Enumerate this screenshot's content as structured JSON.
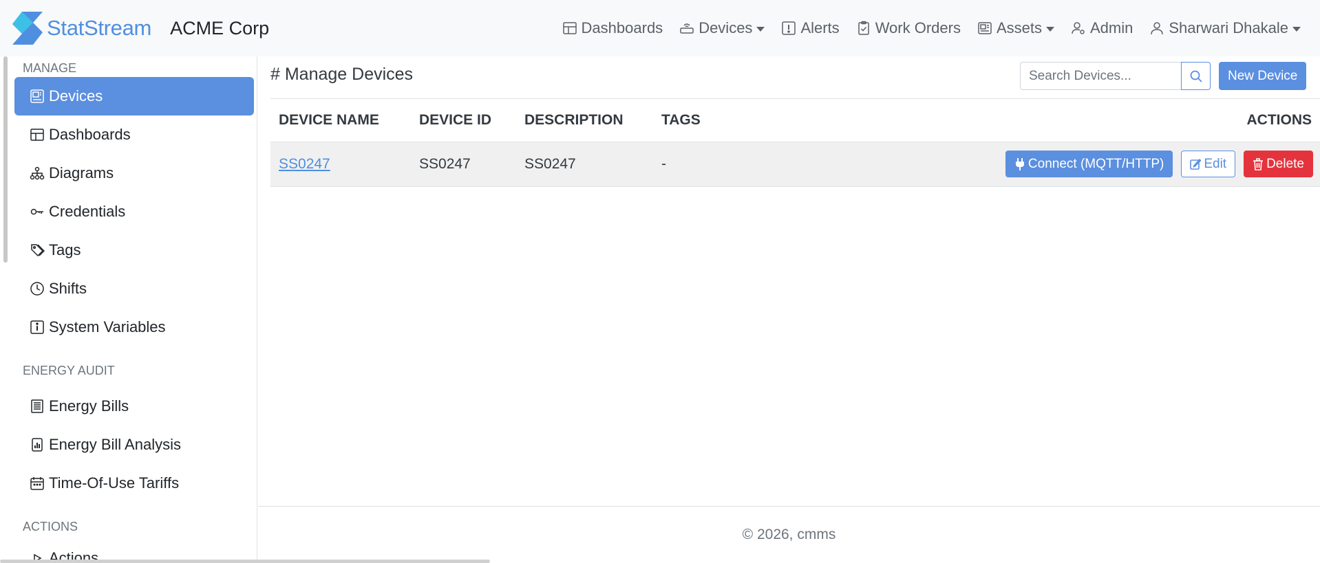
{
  "brand": {
    "name": "StatStream",
    "org": "ACME Corp",
    "colors": {
      "accent": "#5b8fdf",
      "danger": "#e5333d",
      "logo": "#4f8fe0"
    }
  },
  "nav": {
    "dashboards": "Dashboards",
    "devices": "Devices",
    "alerts": "Alerts",
    "work_orders": "Work Orders",
    "assets": "Assets",
    "admin": "Admin",
    "user": "Sharwari Dhakale"
  },
  "sidebar": {
    "manage_title": "MANAGE",
    "manage_items": [
      {
        "label": "Devices",
        "icon": "device-icon",
        "active": true
      },
      {
        "label": "Dashboards",
        "icon": "dashboard-icon"
      },
      {
        "label": "Diagrams",
        "icon": "diagram-icon"
      },
      {
        "label": "Credentials",
        "icon": "key-icon"
      },
      {
        "label": "Tags",
        "icon": "tags-icon"
      },
      {
        "label": "Shifts",
        "icon": "clock-icon"
      },
      {
        "label": "System Variables",
        "icon": "info-icon"
      }
    ],
    "energy_title": "ENERGY AUDIT",
    "energy_items": [
      {
        "label": "Energy Bills",
        "icon": "bill-icon"
      },
      {
        "label": "Energy Bill Analysis",
        "icon": "chart-file-icon"
      },
      {
        "label": "Time-Of-Use Tariffs",
        "icon": "calendar-icon"
      }
    ],
    "actions_title": "ACTIONS",
    "actions_items": [
      {
        "label": "Actions",
        "icon": "triangle-right-icon"
      }
    ]
  },
  "main": {
    "title": "# Manage Devices",
    "search_placeholder": "Search Devices...",
    "new_device": "New Device",
    "table": {
      "headers": [
        "DEVICE NAME",
        "DEVICE ID",
        "DESCRIPTION",
        "TAGS",
        "ACTIONS"
      ],
      "rows": [
        {
          "name": "SS0247",
          "id": "SS0247",
          "description": "SS0247",
          "tags": "-"
        }
      ],
      "connect_label": "Connect (MQTT/HTTP)",
      "edit_label": "Edit",
      "delete_label": "Delete"
    }
  },
  "footer": {
    "text": "© 2026, cmms"
  }
}
